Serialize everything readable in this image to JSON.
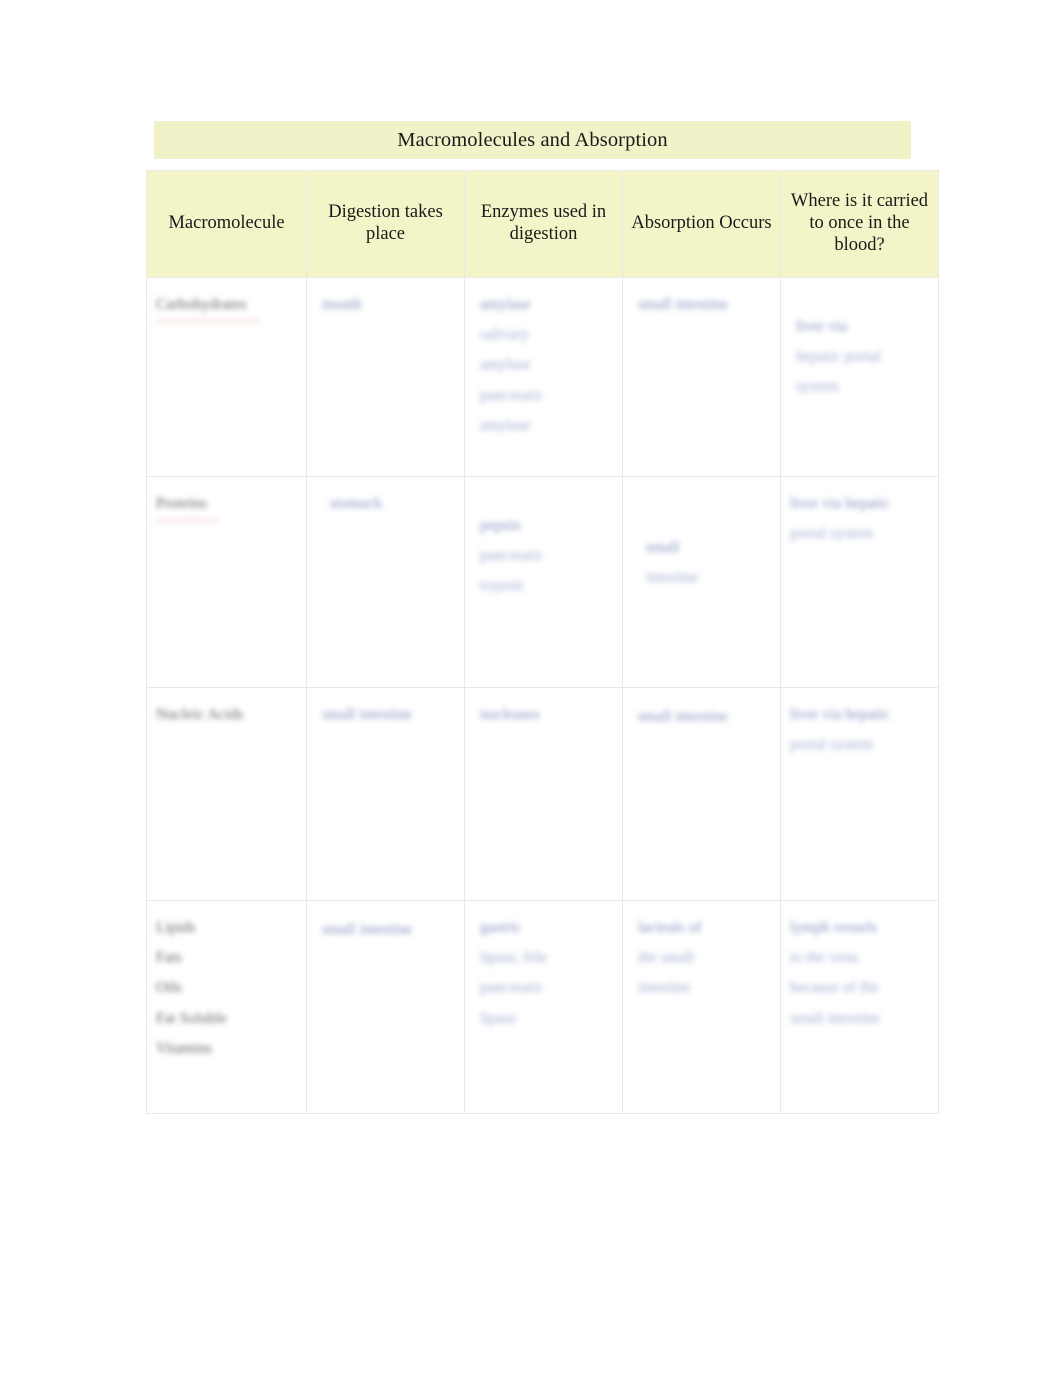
{
  "document": {
    "title": "Macromolecules and Absorption",
    "background_color": "#ffffff",
    "banner_color": "#f2f2c9",
    "header_color": "#f4f4c9",
    "border_color": "#e9e9e9",
    "ink_color": "#6076b2",
    "text_color": "#1a1a1a",
    "spellcheck_color": "#d65c5c"
  },
  "table": {
    "columns": [
      {
        "id": "macromolecule",
        "label": "Macromolecule"
      },
      {
        "id": "digestion_location",
        "label": "Digestion takes place"
      },
      {
        "id": "enzymes",
        "label": "Enzymes used in digestion"
      },
      {
        "id": "absorption",
        "label": "Absorption Occurs"
      },
      {
        "id": "blood_destination",
        "label": "Where is it carried to once in the blood?"
      }
    ],
    "rows": [
      {
        "id": "row-carbohydrates",
        "macromolecule": {
          "lines": [
            "Carbohydrates"
          ],
          "style": "dark",
          "spellcheck": true
        },
        "digestion_location": {
          "lines": [
            "mouth"
          ],
          "style": "ink"
        },
        "enzymes": {
          "lines": [
            "amylase",
            "salivary",
            "amylase",
            "pancreatic",
            "amylase"
          ],
          "style": "ink"
        },
        "absorption": {
          "lines": [
            "small intestine"
          ],
          "style": "ink"
        },
        "blood_destination": {
          "lines": [
            "liver via",
            "hepatic portal",
            "system"
          ],
          "style": "ink"
        }
      },
      {
        "id": "row-proteins",
        "macromolecule": {
          "lines": [
            "Proteins"
          ],
          "style": "dark",
          "spellcheck": true
        },
        "digestion_location": {
          "lines": [
            "stomach"
          ],
          "style": "ink"
        },
        "enzymes": {
          "lines": [
            "pepsin",
            "pancreatic",
            "trypsin"
          ],
          "style": "ink"
        },
        "absorption": {
          "lines": [
            "small",
            "intestine"
          ],
          "style": "ink"
        },
        "blood_destination": {
          "lines": [
            "liver via hepatic",
            "portal system"
          ],
          "style": "ink"
        }
      },
      {
        "id": "row-nucleic-acids",
        "macromolecule": {
          "lines": [
            "Nucleic Acids"
          ],
          "style": "dark",
          "spellcheck": false
        },
        "digestion_location": {
          "lines": [
            "small intestine"
          ],
          "style": "ink"
        },
        "enzymes": {
          "lines": [
            "nucleases"
          ],
          "style": "ink"
        },
        "absorption": {
          "lines": [
            "small intestine"
          ],
          "style": "ink"
        },
        "blood_destination": {
          "lines": [
            "liver via hepatic",
            "portal system"
          ],
          "style": "ink"
        }
      },
      {
        "id": "row-lipids",
        "macromolecule": {
          "lines": [
            "Lipids",
            "Fats",
            "Oils",
            "Fat Soluble",
            "Vitamins"
          ],
          "style": "dark",
          "spellcheck": false
        },
        "digestion_location": {
          "lines": [
            "small intestine"
          ],
          "style": "ink"
        },
        "enzymes": {
          "lines": [
            "gastric",
            "lipase, bile",
            "pancreatic",
            "lipase"
          ],
          "style": "ink"
        },
        "absorption": {
          "lines": [
            "lacteals of",
            "the small",
            "intestine"
          ],
          "style": "ink"
        },
        "blood_destination": {
          "lines": [
            "lymph vessels",
            "to the vena",
            "because of the",
            "small intestine"
          ],
          "style": "ink"
        }
      }
    ]
  }
}
